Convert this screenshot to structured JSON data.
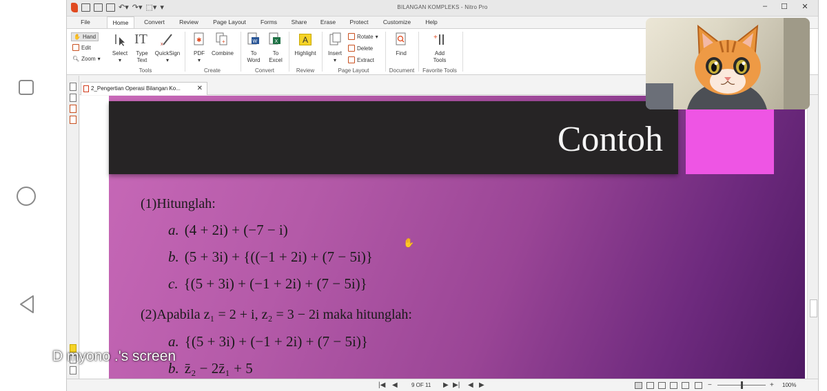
{
  "window": {
    "title": "BILANGAN KOMPLEKS - Nitro Pro",
    "minimize": "–",
    "maximize": "☐",
    "close": "✕"
  },
  "ribbon_tabs": [
    "File",
    "Home",
    "Convert",
    "Review",
    "Page Layout",
    "Forms",
    "Share",
    "Erase",
    "Protect",
    "Customize",
    "Help"
  ],
  "ribbon": {
    "hand": "Hand",
    "edit": "Edit",
    "zoom": "Zoom",
    "select": "Select",
    "type_text_1": "Type",
    "type_text_2": "Text",
    "quicksign": "QuickSign",
    "group_tools": "Tools",
    "pdf": "PDF",
    "combine": "Combine",
    "group_create": "Create",
    "to_word_1": "To",
    "to_word_2": "Word",
    "to_excel_1": "To",
    "to_excel_2": "Excel",
    "group_convert": "Convert",
    "highlight": "Highlight",
    "group_review": "Review",
    "insert": "Insert",
    "rotate": "Rotate",
    "delete": "Delete",
    "extract": "Extract",
    "group_page_layout": "Page Layout",
    "find": "Find",
    "group_document": "Document",
    "add_tools_1": "Add",
    "add_tools_2": "Tools",
    "group_favorite": "Favorite Tools"
  },
  "doc_tab": {
    "name": "2_Pengertian  Operasi Bilangan Ko...",
    "close": "✕"
  },
  "slide": {
    "title": "Contoh",
    "q1": "(1)Hitunglah:",
    "q1_items": [
      {
        "label": "a.",
        "expr": "(4 + 2i) + (−7 − i)"
      },
      {
        "label": "b.",
        "expr": "(5 + 3i) + {((−1 + 2i) + (7 − 5i)}"
      },
      {
        "label": "c.",
        "expr": "{(5 + 3i) + (−1 + 2i) + (7 − 5i)}"
      }
    ],
    "q2": "(2)Apabila z₁ = 2 + i, z₂ = 3 − 2i maka hitunglah:",
    "q2_items": [
      {
        "label": "a.",
        "expr": "{(5 + 3i) + (−1 + 2i) + (7 − 5i)}"
      },
      {
        "label": "b.",
        "expr": "z̄₂ − 2z̄₁ + 5"
      }
    ]
  },
  "status": {
    "page_indicator": "9 OF 11",
    "zoom": "100%",
    "zoom_minus": "−",
    "zoom_plus": "+"
  },
  "overlay": {
    "screen_label": "D  myono .'s screen"
  },
  "colors": {
    "slide_dark_bar": "#262425",
    "slide_pink_block": "#ee55e4",
    "slide_gradient_start": "#c869b8",
    "slide_gradient_end": "#4e1a63",
    "nitro_accent": "#e0491f"
  }
}
